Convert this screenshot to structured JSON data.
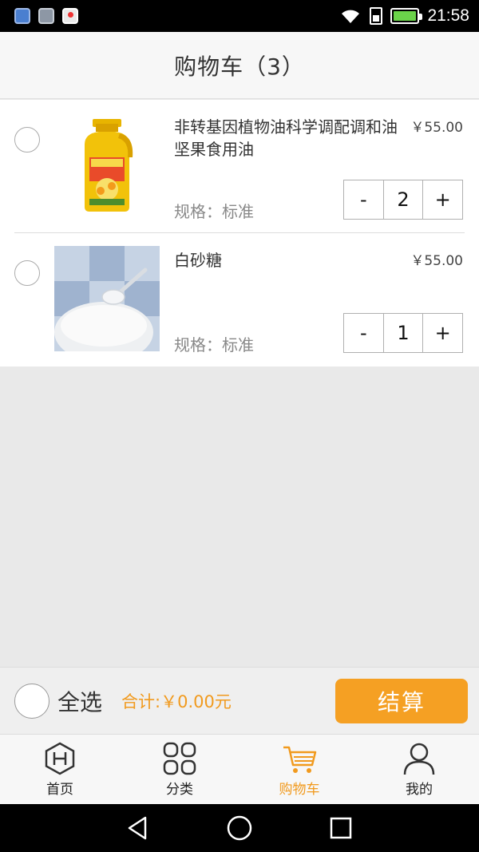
{
  "status": {
    "time": "21:58"
  },
  "header": {
    "title": "购物车（3）"
  },
  "cart": {
    "items": [
      {
        "name": "非转基因植物油科学调配调和油坚果食用油",
        "price": "￥55.00",
        "spec": "规格：标准",
        "quantity": "2",
        "image": "oil-bottle"
      },
      {
        "name": "白砂糖",
        "price": "￥55.00",
        "spec": "规格：标准",
        "quantity": "1",
        "image": "sugar-bowl"
      }
    ],
    "decrement_label": "-",
    "increment_label": "+"
  },
  "checkout": {
    "select_all_label": "全选",
    "total_label": "合计:￥0.00元",
    "checkout_label": "结算",
    "accent_color": "#f5a023"
  },
  "tabs": [
    {
      "label": "首页",
      "icon": "home-hex-icon"
    },
    {
      "label": "分类",
      "icon": "category-grid-icon"
    },
    {
      "label": "购物车",
      "icon": "cart-icon",
      "active": true
    },
    {
      "label": "我的",
      "icon": "user-icon"
    }
  ]
}
